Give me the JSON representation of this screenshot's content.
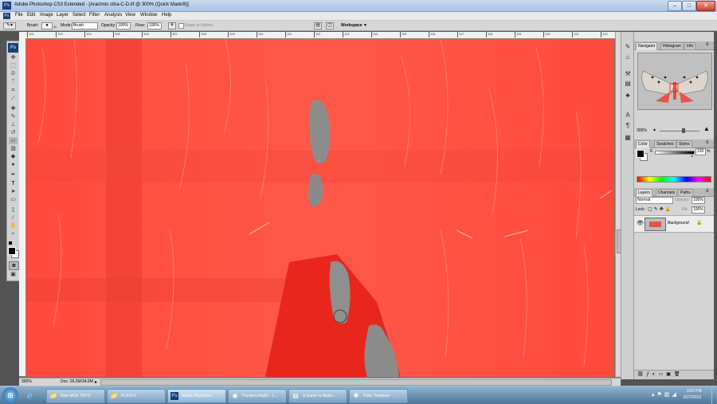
{
  "window": {
    "title": "Adobe Photoshop CS3 Extended - [Arachnis citra-C-D.tif @ 300% (Quick Mask/8)]",
    "app_icon_label": "Ps",
    "minimize": "–",
    "maximize": "□",
    "close": "✕"
  },
  "menu": [
    "File",
    "Edit",
    "Image",
    "Layer",
    "Select",
    "Filter",
    "Analysis",
    "View",
    "Window",
    "Help"
  ],
  "options_bar": {
    "brush_label": "Brush:",
    "brush_size": "11",
    "mode_label": "Mode:",
    "mode_value": "Brush",
    "opacity_label": "Opacity:",
    "opacity_value": "100%",
    "flow_label": "Flow:",
    "flow_value": "100%",
    "erase_to_history": "Erase to History",
    "workspace": "Workspace ▼"
  },
  "ruler": {
    "ticks": [
      "102",
      "103",
      "104",
      "105",
      "106",
      "107",
      "108",
      "109",
      "110",
      "111",
      "112",
      "113",
      "114",
      "115",
      "116",
      "117",
      "118",
      "119",
      "120",
      "121",
      "122"
    ]
  },
  "status": {
    "zoom": "300%",
    "doc": "Doc: 28.2M/34.6M"
  },
  "toolbox": {
    "logo": "Ps",
    "tools": [
      "move-icon",
      "marquee-icon",
      "lasso-icon",
      "magic-wand-icon",
      "crop-icon",
      "slice-icon",
      "healing-icon",
      "brush-icon",
      "stamp-icon",
      "history-brush-icon",
      "eraser-icon",
      "gradient-icon",
      "blur-icon",
      "dodge-icon",
      "pen-icon",
      "type-icon",
      "path-select-icon",
      "shape-icon",
      "notes-icon",
      "eyedropper-icon",
      "hand-icon",
      "zoom-icon"
    ]
  },
  "navigator": {
    "tabs": [
      "Navigator",
      "Histogram",
      "Info"
    ],
    "zoom": "300%"
  },
  "color_panel": {
    "tabs": [
      "Color",
      "Swatches",
      "Styles"
    ],
    "channel_label": "K",
    "channel_value": "100",
    "percent": "%"
  },
  "layers_panel": {
    "tabs": [
      "Layers",
      "Channels",
      "Paths"
    ],
    "blend_mode": "Normal",
    "opacity_label": "Opacity:",
    "opacity_value": "100%",
    "lock_label": "Lock:",
    "fill_label": "Fill:",
    "fill_value": "100%",
    "layer_name": "Background"
  },
  "taskbar": {
    "items": [
      {
        "label": "New Moth TIFFS",
        "icon": "folder-icon"
      },
      {
        "label": "PLATES",
        "icon": "folder-icon"
      },
      {
        "label": "Adobe Photosho...",
        "icon": "photoshop-icon"
      },
      {
        "label": "Pandora Radio - L...",
        "icon": "chrome-icon"
      },
      {
        "label": "A Guide to Makin...",
        "icon": "document-icon"
      },
      {
        "label": "Plate Template - ...",
        "icon": "photoshop-icon"
      }
    ],
    "time": "9:02 PM",
    "date": "6/27/2012"
  },
  "colors": {
    "mask_red": "#ff4b3e",
    "fur_gray": "#8d8d8d",
    "taskbar_blue": "#4e7597"
  }
}
